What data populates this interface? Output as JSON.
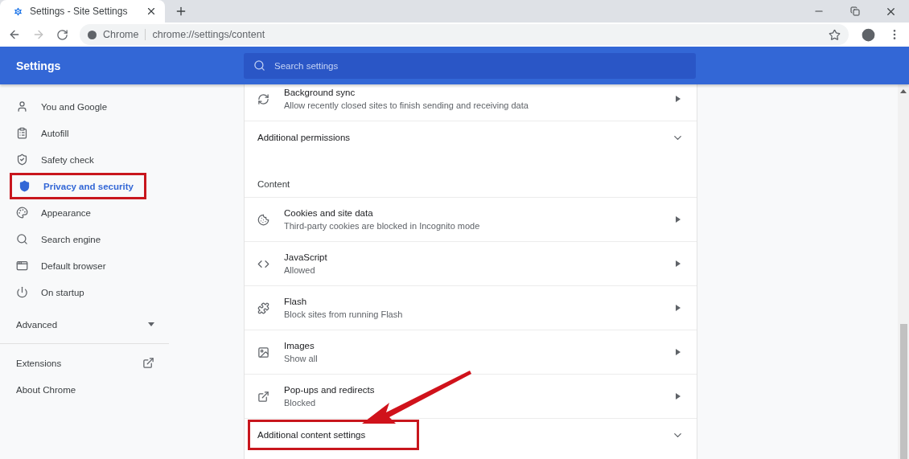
{
  "tab": {
    "title": "Settings - Site Settings",
    "selected": true
  },
  "toolbar": {
    "back_disabled": false,
    "forward_disabled": true,
    "site_label": "Chrome",
    "url": "chrome://settings/content"
  },
  "header": {
    "title": "Settings",
    "search": {
      "placeholder": "Search settings"
    }
  },
  "sidebar": {
    "items": [
      {
        "label": "You and Google",
        "selected": false,
        "highlighted": false
      },
      {
        "label": "Autofill",
        "selected": false,
        "highlighted": false
      },
      {
        "label": "Safety check",
        "selected": false,
        "highlighted": false
      },
      {
        "label": "Privacy and security",
        "selected": true,
        "highlighted": true
      },
      {
        "label": "Appearance",
        "selected": false,
        "highlighted": false
      },
      {
        "label": "Search engine",
        "selected": false,
        "highlighted": false
      },
      {
        "label": "Default browser",
        "selected": false,
        "highlighted": false
      },
      {
        "label": "On startup",
        "selected": false,
        "highlighted": false
      }
    ],
    "advanced": {
      "label": "Advanced",
      "expanded": false
    },
    "links": [
      {
        "label": "Extensions",
        "external": true
      },
      {
        "label": "About Chrome",
        "external": false
      }
    ]
  },
  "rows": [
    {
      "kind": "link",
      "title": "Background sync",
      "subtitle": "Allow recently closed sites to finish sending and receiving data"
    },
    {
      "kind": "expander",
      "title": "Additional permissions",
      "expanded": false,
      "highlighted": false
    },
    {
      "kind": "heading",
      "title": "Content"
    },
    {
      "kind": "link",
      "title": "Cookies and site data",
      "subtitle": "Third-party cookies are blocked in Incognito mode"
    },
    {
      "kind": "link",
      "title": "JavaScript",
      "subtitle": "Allowed"
    },
    {
      "kind": "link",
      "title": "Flash",
      "subtitle": "Block sites from running Flash"
    },
    {
      "kind": "link",
      "title": "Images",
      "subtitle": "Show all"
    },
    {
      "kind": "link",
      "title": "Pop-ups and redirects",
      "subtitle": "Blocked"
    },
    {
      "kind": "expander",
      "title": "Additional content settings",
      "expanded": false,
      "highlighted": true
    }
  ]
}
